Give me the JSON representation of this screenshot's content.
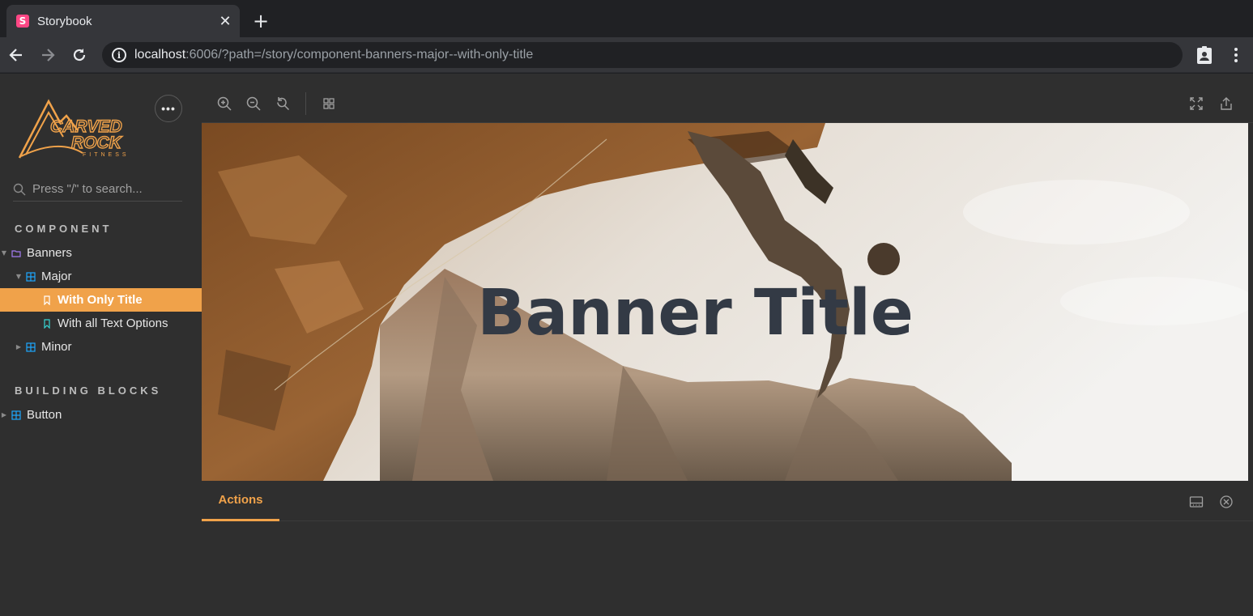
{
  "browser": {
    "tab_title": "Storybook",
    "tab_favicon_letter": "S",
    "url_host": "localhost",
    "url_rest": ":6006/?path=/story/component-banners-major--with-only-title"
  },
  "sidebar": {
    "logo_text": "CARVED ROCK FITNESS",
    "menu_label": "•••",
    "search_placeholder": "Press \"/\" to search...",
    "sections": [
      {
        "label": "COMPONENT"
      },
      {
        "label": "BUILDING BLOCKS"
      }
    ],
    "items": [
      {
        "label": "Banners",
        "icon": "folder-icon"
      },
      {
        "label": "Major",
        "icon": "component-icon"
      },
      {
        "label": "With Only Title",
        "icon": "bookmark-icon",
        "active": true
      },
      {
        "label": "With all Text Options",
        "icon": "bookmark-icon"
      },
      {
        "label": "Minor",
        "icon": "component-icon"
      },
      {
        "label": "Button",
        "icon": "component-icon"
      }
    ]
  },
  "preview": {
    "banner_title": "Banner Title"
  },
  "panel": {
    "tabs": [
      {
        "label": "Actions"
      }
    ]
  },
  "colors": {
    "accent": "#f0a24a",
    "folder": "#a47cf3",
    "component": "#1ea7fd",
    "story": "#37d5d3"
  }
}
